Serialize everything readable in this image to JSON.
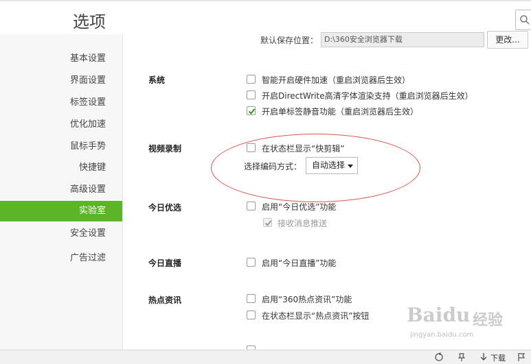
{
  "header": {
    "title": "选项"
  },
  "sidebar": {
    "items": [
      {
        "label": "基本设置"
      },
      {
        "label": "界面设置"
      },
      {
        "label": "标签设置"
      },
      {
        "label": "优化加速"
      },
      {
        "label": "鼠标手势"
      },
      {
        "label": "快捷键"
      },
      {
        "label": "高级设置"
      },
      {
        "label": "实验室",
        "active": true
      },
      {
        "label": "安全设置"
      },
      {
        "label": "广告过滤"
      }
    ]
  },
  "download": {
    "label": "默认保存位置：",
    "path": "D:\\360安全浏览器下载",
    "change_button": "更改..."
  },
  "system": {
    "title": "系统",
    "options": [
      {
        "label": "智能开启硬件加速（重启浏览器后生效）",
        "checked": false
      },
      {
        "label": "开启DirectWrite高清字体渲染支持（重启浏览器后生效）",
        "checked": false
      },
      {
        "label": "开启单标签静音功能（重启浏览器后生效）",
        "checked": true
      }
    ]
  },
  "video": {
    "title": "视频录制",
    "show_statusbar": {
      "label": "在状态栏显示“快剪辑”",
      "checked": false
    },
    "encode_label": "选择编码方式：",
    "encode_value": "自动选择"
  },
  "today_pick": {
    "title": "今日优选",
    "enable": {
      "label": "启用“今日优选”功能",
      "checked": false
    },
    "push": {
      "label": "接收消息推送",
      "checked": true,
      "disabled": true
    }
  },
  "today_live": {
    "title": "今日直播",
    "enable": {
      "label": "启用“今日直播”功能",
      "checked": false
    }
  },
  "hot_news": {
    "title": "热点资讯",
    "enable": {
      "label": "启用“360热点资讯”功能",
      "checked": false
    },
    "statusbar_button": {
      "label": "在状态栏显示“热点资讯”按钮",
      "checked": false
    }
  },
  "statusbar": {
    "download_label": "下载"
  },
  "watermark": {
    "brand": "Baidu",
    "brand_cn": "经验",
    "url": "jingyan.baidu.com"
  },
  "colors": {
    "accent": "#5bb527",
    "annotation": "#d9534f"
  }
}
